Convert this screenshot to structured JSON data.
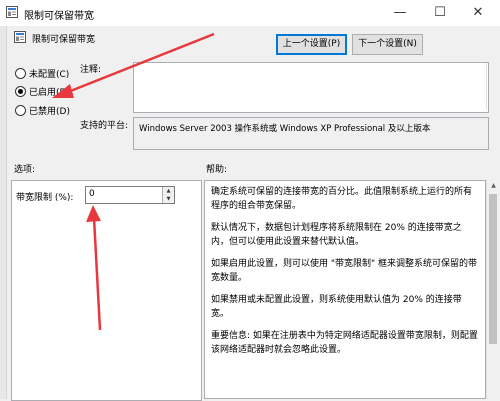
{
  "window": {
    "title": "限制可保留带宽",
    "minimize_glyph": "—",
    "maximize_glyph": "☐",
    "close_glyph": "✕"
  },
  "header": {
    "policy_name": "限制可保留带宽",
    "prev_button": "上一个设置(P)",
    "next_button": "下一个设置(N)"
  },
  "state": {
    "options": [
      {
        "label": "未配置(C)",
        "checked": false
      },
      {
        "label": "已启用(E)",
        "checked": true
      },
      {
        "label": "已禁用(D)",
        "checked": false
      }
    ]
  },
  "comment": {
    "label": "注释:",
    "value": ""
  },
  "platform": {
    "label": "支持的平台:",
    "value": "Windows Server 2003 操作系统或 Windows XP Professional 及以上版本"
  },
  "options_section": {
    "heading": "选项:",
    "bandwidth_label": "带宽限制 (%):",
    "bandwidth_value": "0"
  },
  "help_section": {
    "heading": "帮助:",
    "paragraphs": [
      "确定系统可保留的连接带宽的百分比。此值限制系统上运行的所有程序的组合带宽保留。",
      "默认情况下，数据包计划程序将系统限制在 20% 的连接带宽之内，但可以使用此设置来替代默认值。",
      "如果启用此设置，则可以使用 \"带宽限制\" 框来调整系统可保留的带宽数量。",
      "如果禁用或未配置此设置，则系统使用默认值为 20% 的连接带宽。",
      "重要信息: 如果在注册表中为特定网络适配器设置带宽限制，则配置该网络适配器时就会忽略此设置。"
    ]
  },
  "colors": {
    "annotation_arrow": "#e8383d",
    "focus_border": "#0078d7"
  }
}
